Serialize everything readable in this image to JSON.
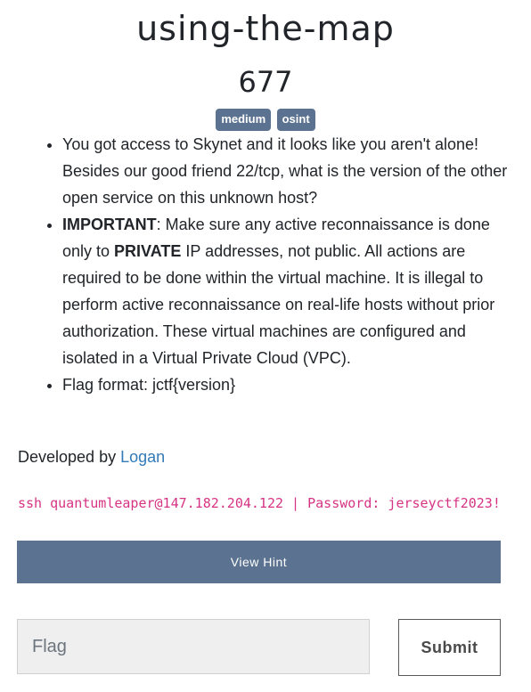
{
  "challenge": {
    "name": "using-the-map",
    "value": "677",
    "tags": [
      "medium",
      "osint"
    ]
  },
  "description": {
    "bullets": [
      {
        "text": "You got access to Skynet and it looks like you aren't alone! Besides our good friend 22/tcp, what is the version of the other open service on this unknown host?"
      },
      {
        "important_label": "IMPORTANT",
        "important_text_1": ": Make sure any active reconnaissance is done only to ",
        "private_label": "PRIVATE",
        "important_text_2": " IP addresses, not public. All actions are required to be done within the virtual machine. It is illegal to perform active reconnaissance on real-life hosts without prior authorization. These virtual machines are configured and isolated in a Virtual Private Cloud (VPC)."
      },
      {
        "text": "Flag format: jctf{version}"
      }
    ]
  },
  "developer": {
    "prefix": "Developed by ",
    "name": "Logan"
  },
  "connection": {
    "text": "ssh quantumleaper@147.182.204.122 | Password: jerseyctf2023!"
  },
  "hint_button": {
    "label": "View Hint"
  },
  "flag_form": {
    "placeholder": "Flag",
    "value": "",
    "submit_label": "Submit"
  },
  "colors": {
    "accent": "#5b7290",
    "link": "#337ab7",
    "code": "#d63384"
  }
}
